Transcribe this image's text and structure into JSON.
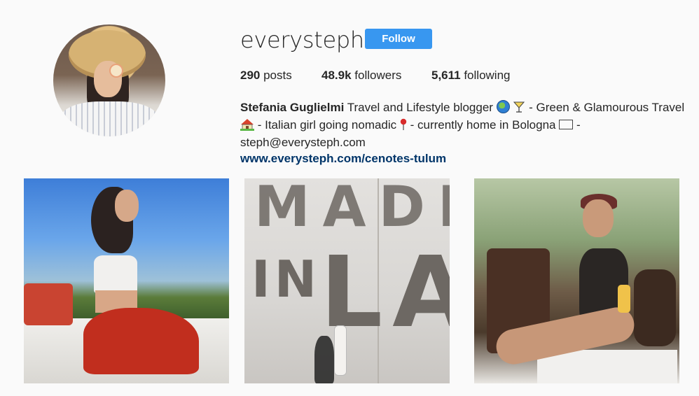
{
  "profile": {
    "username": "everysteph",
    "follow_label": "Follow",
    "follow_color": "#3897f0"
  },
  "stats": {
    "posts_count": "290",
    "posts_label": " posts",
    "followers_count": "48.9k",
    "followers_label": " followers",
    "following_count": "5,611",
    "following_label": " following"
  },
  "bio": {
    "full_name": "Stefania Guglielmi",
    "line1_text": " Travel and Lifestyle blogger ",
    "line1_tail": " - Green & Glamourous Travel",
    "line2_text": " - Italian girl going nomadic ",
    "line2_mid": " - currently home in Bologna ",
    "line2_tail": " -",
    "email": "steph@everysteph.com",
    "website": "www.everysteph.com/cenotes-tulum",
    "icons": [
      "globe-emoji",
      "cocktail-emoji",
      "house-emoji",
      "pin-emoji",
      "envelope-emoji"
    ]
  },
  "posts": {
    "grid": [
      "post-woman-on-boat",
      "post-made-in-la-wall",
      "post-woman-on-bench"
    ],
    "wall_text_line1": "MADE",
    "wall_text_in": "IN",
    "wall_text_la": "LA"
  }
}
